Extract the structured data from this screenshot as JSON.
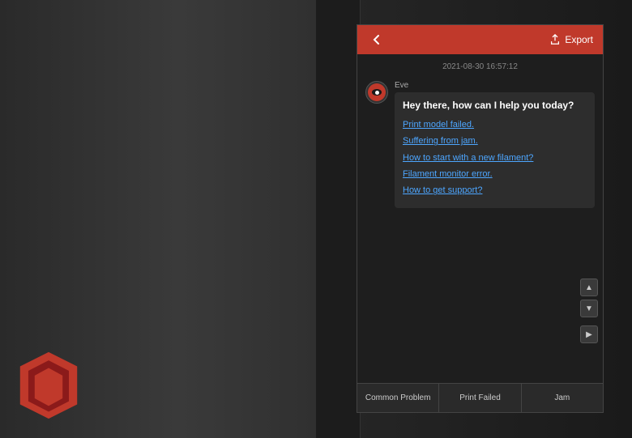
{
  "background": {
    "left_color": "#2a2a2a",
    "right_color": "#1a1a1a"
  },
  "top_bar": {
    "back_label": "‹",
    "export_label": "Export",
    "color": "#c0392b"
  },
  "chat": {
    "timestamp": "2021-08-30 16:57:12",
    "messages": [
      {
        "sender": "Eve",
        "text": "Hey there, how can I help you today?",
        "links": [
          "Print model failed.",
          "Suffering from jam.",
          "How to start with a new filament?",
          "Filament monitor error.",
          "How to get support?"
        ]
      }
    ]
  },
  "toolbar": {
    "buttons": [
      {
        "label": "Common Problem"
      },
      {
        "label": "Print Failed"
      },
      {
        "label": "Jam"
      }
    ]
  },
  "scroll": {
    "up_icon": "▲",
    "down_icon": "▼",
    "send_icon": "▶"
  }
}
